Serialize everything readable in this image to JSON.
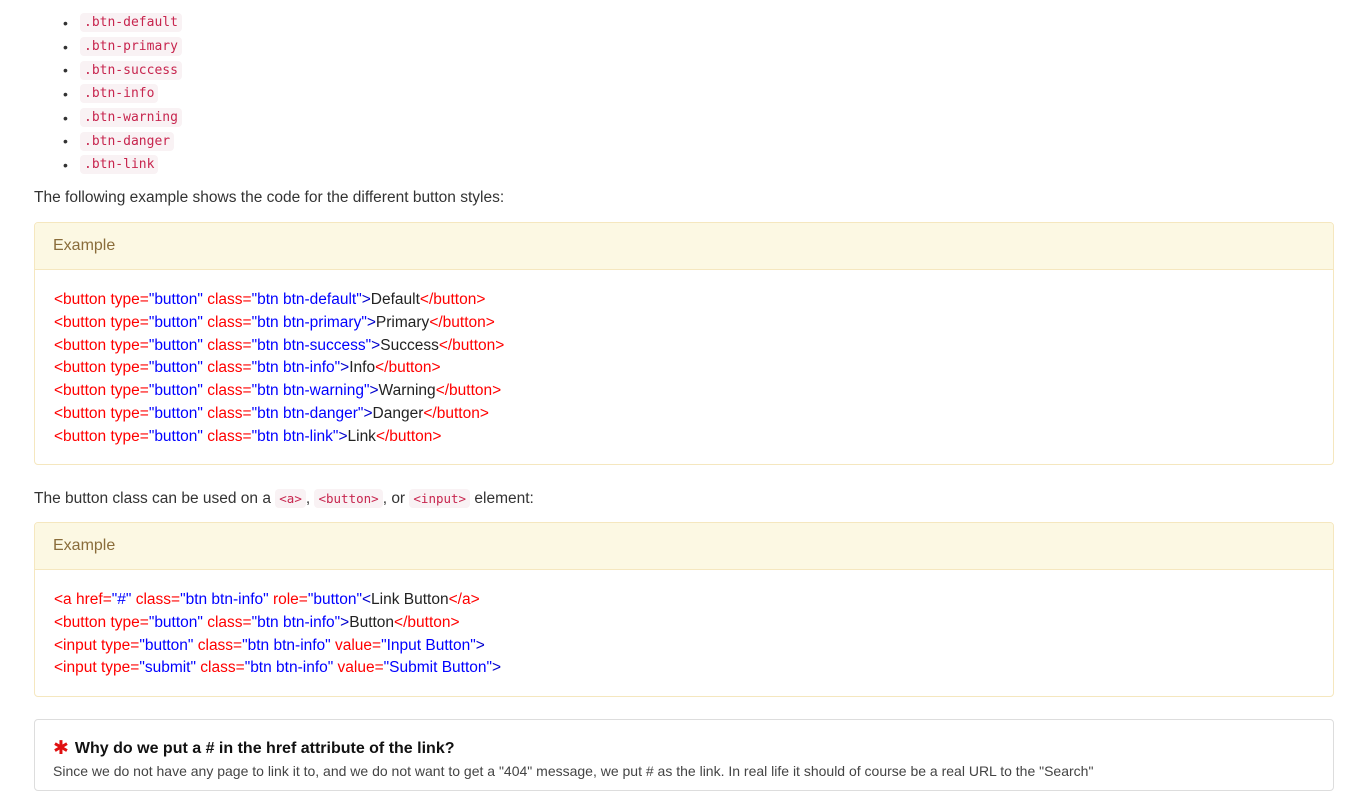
{
  "class_list": [
    ".btn-default",
    ".btn-primary",
    ".btn-success",
    ".btn-info",
    ".btn-warning",
    ".btn-danger",
    ".btn-link"
  ],
  "intro_text": "The following example shows the code for the different button styles:",
  "example1": {
    "heading": "Example",
    "lines": [
      {
        "open": "<button",
        "attr1": " type=",
        "val1": "\"button\"",
        "attr2": " class=",
        "val2": "\"btn btn-default\"",
        "close": ">",
        "text": "Default",
        "end": "</button>",
        "endp": ">"
      },
      {
        "open": "<button",
        "attr1": " type=",
        "val1": "\"button\"",
        "attr2": " class=",
        "val2": "\"btn btn-primary\"",
        "close": ">",
        "text": "Primary",
        "end": "</button",
        "endp": ">"
      },
      {
        "open": "<button",
        "attr1": " type=",
        "val1": "\"button\"",
        "attr2": " class=",
        "val2": "\"btn btn-success\"",
        "close": ">",
        "text": "Success",
        "end": "</button",
        "endp": ">"
      },
      {
        "open": "<button",
        "attr1": " type=",
        "val1": "\"button\"",
        "attr2": " class=",
        "val2": "\"btn btn-info\"",
        "close": ">",
        "text": "Info",
        "end": "</button",
        "endp": ">"
      },
      {
        "open": "<button",
        "attr1": " type=",
        "val1": "\"button\"",
        "attr2": " class=",
        "val2": "\"btn btn-warning\"",
        "close": ">",
        "text": "Warning",
        "end": "</button",
        "endp": ">"
      },
      {
        "open": "<button",
        "attr1": " type=",
        "val1": "\"button\"",
        "attr2": " class=",
        "val2": "\"btn btn-danger\"",
        "close": ">",
        "text": "Danger",
        "end": "</button",
        "endp": ">"
      },
      {
        "open": "<button",
        "attr1": " type=",
        "val1": "\"button\"",
        "attr2": " class=",
        "val2": "\"btn btn-link\"",
        "close": ">",
        "text": "Link",
        "end": "</button",
        "endp": ">"
      }
    ]
  },
  "para2": {
    "before": "The button class can be used on a ",
    "code1": "<a>",
    "sep1": ", ",
    "code2": "<button>",
    "sep2": ", or ",
    "code3": "<input>",
    "after": " element:"
  },
  "example2": {
    "heading": "Example",
    "line1": {
      "open": "<a",
      "attr1": " href=",
      "val1": "\"#\"",
      "attr2": " class=",
      "val2": "\"btn btn-info\"",
      "attr3": " role=",
      "val3": "\"button\"",
      "close": "<",
      "text": "Link Button",
      "end": "</a",
      "endp": ">"
    },
    "line2": {
      "open": "<button",
      "attr1": " type=",
      "val1": "\"button\"",
      "attr2": " class=",
      "val2": "\"btn btn-info\"",
      "close": ">",
      "text": "Button",
      "end": "</button",
      "endp": ">"
    },
    "line3": {
      "open": "<input",
      "attr1": " type=",
      "val1": "\"button\"",
      "attr2": " class=",
      "val2": "\"btn btn-info\"",
      "attr3": " value=",
      "val3": "\"Input Button\"",
      "endp": ">"
    },
    "line4": {
      "open": "<input",
      "attr1": " type=",
      "val1": "\"submit\"",
      "attr2": " class=",
      "val2": "\"btn btn-info\"",
      "attr3": " value=",
      "val3": "\"Submit Button\"",
      "endp": ">"
    }
  },
  "note": {
    "icon": "asterisk-icon",
    "title": "Why do we put a # in the href attribute of the link?",
    "text": "Since we do not have any page to link it to, and we do not want to get a \"404\" message, we put # as the link. In real life it should of course be a real URL to the \"Search\""
  },
  "colors": {
    "code_text": "#c7254e",
    "code_bg": "#f9f2f4",
    "example_head_bg": "#fcf8e3",
    "tag": "#ff0000",
    "value": "#0000ff"
  }
}
